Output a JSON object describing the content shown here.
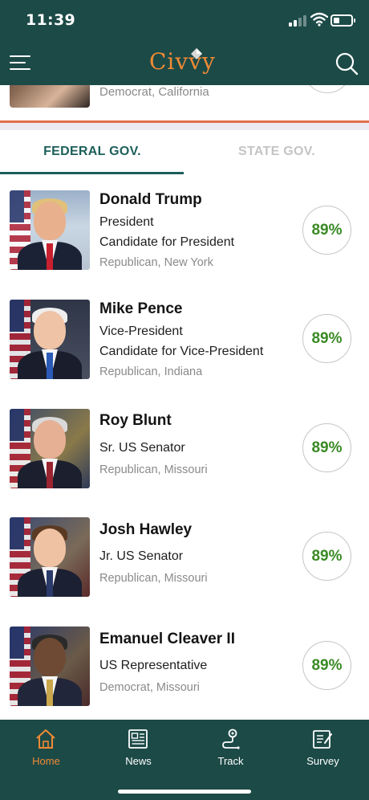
{
  "status": {
    "time": "11:39"
  },
  "header": {
    "logo_text": "Civvy",
    "brand_color": "#f08a34",
    "bar_color": "#1c4a47"
  },
  "previous": {
    "party": "Democrat, California"
  },
  "tabs": [
    {
      "label": "FEDERAL GOV.",
      "active": true
    },
    {
      "label": "STATE GOV.",
      "active": false
    }
  ],
  "officials": [
    {
      "name": "Donald Trump",
      "role1": "President",
      "role2": "Candidate for President",
      "party": "Republican, New York",
      "score": "89%"
    },
    {
      "name": "Mike Pence",
      "role1": "Vice-President",
      "role2": "Candidate for Vice-President",
      "party": "Republican, Indiana",
      "score": "89%"
    },
    {
      "name": "Roy Blunt",
      "role1": "Sr. US Senator",
      "role2": "",
      "party": "Republican, Missouri",
      "score": "89%"
    },
    {
      "name": "Josh Hawley",
      "role1": "Jr. US Senator",
      "role2": "",
      "party": "Republican, Missouri",
      "score": "89%"
    },
    {
      "name": "Emanuel Cleaver II",
      "role1": "US Representative",
      "role2": "",
      "party": "Democrat, Missouri",
      "score": "89%"
    }
  ],
  "nav": [
    {
      "label": "Home",
      "icon": "home-icon",
      "active": true
    },
    {
      "label": "News",
      "icon": "news-icon",
      "active": false
    },
    {
      "label": "Track",
      "icon": "track-icon",
      "active": false
    },
    {
      "label": "Survey",
      "icon": "survey-icon",
      "active": false
    }
  ]
}
